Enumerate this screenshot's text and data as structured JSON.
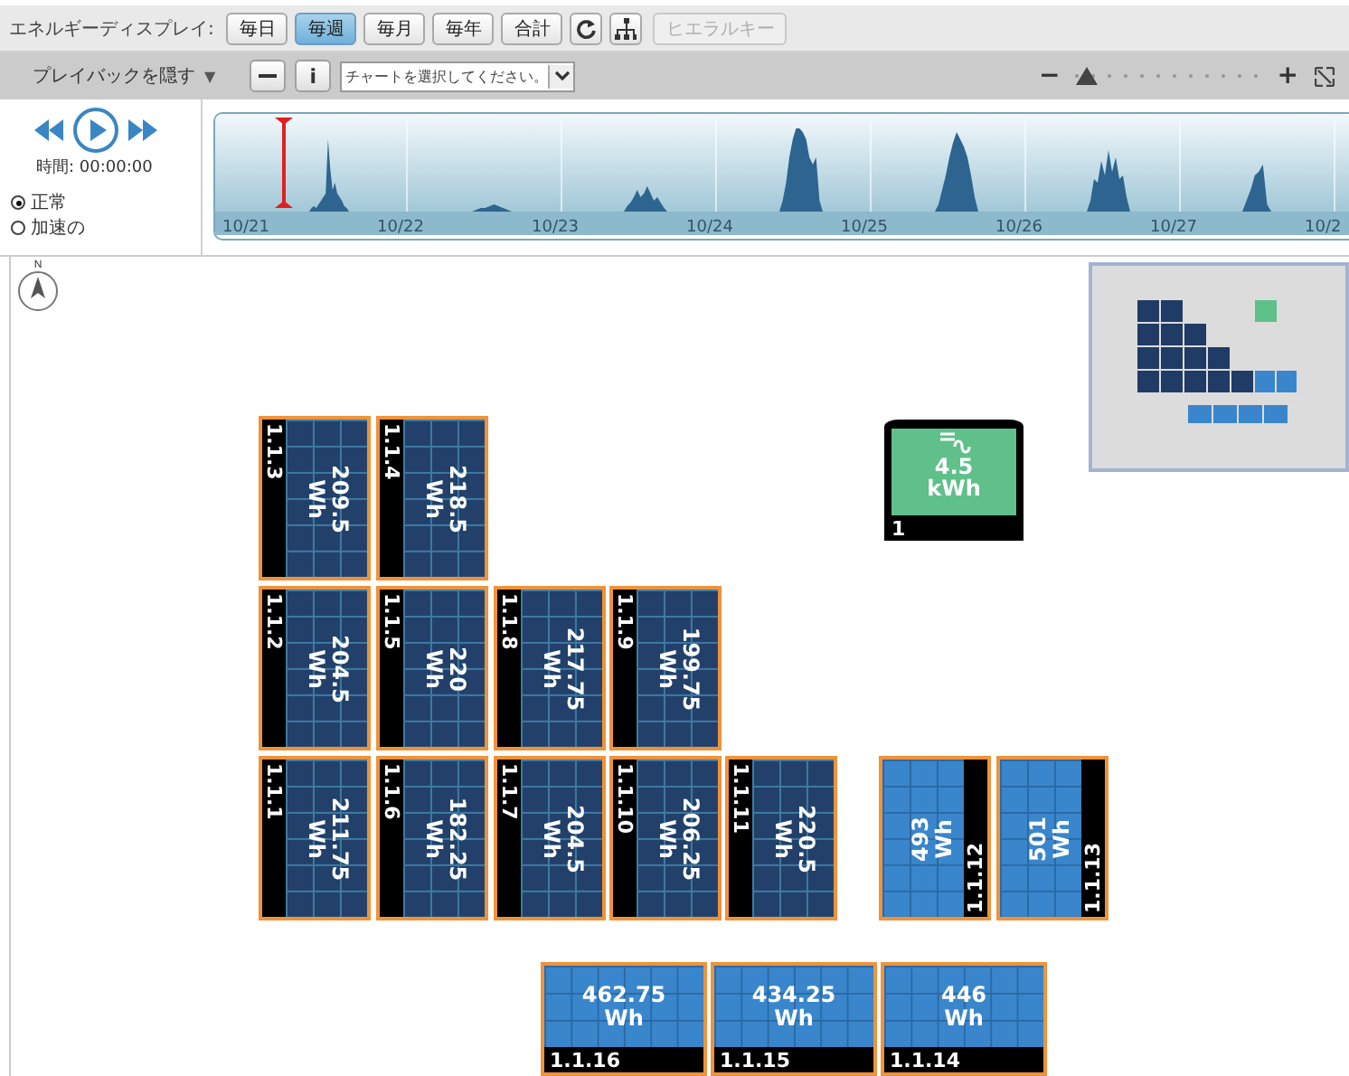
{
  "toolbar": {
    "label": "エネルギーディスプレイ:",
    "periods": [
      {
        "label": "毎日",
        "selected": false
      },
      {
        "label": "毎週",
        "selected": true
      },
      {
        "label": "毎月",
        "selected": false
      },
      {
        "label": "毎年",
        "selected": false
      },
      {
        "label": "合計",
        "selected": false
      }
    ],
    "hierarchy_button": {
      "label": "ヒエラルキー",
      "disabled": true
    }
  },
  "playback_bar": {
    "toggle": "プレイバックを隠す",
    "toggle_arrow": "▼",
    "info_button": "i",
    "chart_select": {
      "placeholder": "チャートを選択してください。"
    },
    "zoom_out": "−",
    "zoom_in": "+",
    "zoom": {
      "level": 0.03
    }
  },
  "player": {
    "time": "時間: 00:00:00",
    "speeds": [
      {
        "label": "正常",
        "selected": true
      },
      {
        "label": "加速の",
        "selected": false
      }
    ]
  },
  "timeline": {
    "level": 0.03,
    "dates": [
      "10/21",
      "10/22",
      "10/23",
      "10/24",
      "10/25",
      "10/26",
      "10/27",
      "10/2"
    ]
  },
  "compass": "N",
  "inverter": {
    "value": "4.5",
    "unit": "kWh",
    "label": "1"
  },
  "panels": [
    {
      "label": "1.1.3",
      "value": "209.5",
      "unit": "Wh",
      "kind": "left"
    },
    {
      "label": "1.1.4",
      "value": "218.5",
      "unit": "Wh",
      "kind": "left"
    },
    {
      "label": "1.1.2",
      "value": "204.5",
      "unit": "Wh",
      "kind": "left"
    },
    {
      "label": "1.1.5",
      "value": "220",
      "unit": "Wh",
      "kind": "left"
    },
    {
      "label": "1.1.8",
      "value": "217.75",
      "unit": "Wh",
      "kind": "left"
    },
    {
      "label": "1.1.9",
      "value": "199.75",
      "unit": "Wh",
      "kind": "left"
    },
    {
      "label": "1.1.1",
      "value": "211.75",
      "unit": "Wh",
      "kind": "left"
    },
    {
      "label": "1.1.6",
      "value": "182.25",
      "unit": "Wh",
      "kind": "left"
    },
    {
      "label": "1.1.7",
      "value": "204.5",
      "unit": "Wh",
      "kind": "left"
    },
    {
      "label": "1.1.10",
      "value": "206.25",
      "unit": "Wh",
      "kind": "left"
    },
    {
      "label": "1.1.11",
      "value": "220.5",
      "unit": "Wh",
      "kind": "left"
    },
    {
      "label": "1.1.12",
      "value": "493",
      "unit": "Wh",
      "kind": "right"
    },
    {
      "label": "1.1.13",
      "value": "501",
      "unit": "Wh",
      "kind": "right"
    },
    {
      "label": "1.1.16",
      "value": "462.75",
      "unit": "Wh",
      "kind": "bottom"
    },
    {
      "label": "1.1.15",
      "value": "434.25",
      "unit": "Wh",
      "kind": "bottom"
    },
    {
      "label": "1.1.14",
      "value": "446",
      "unit": "Wh",
      "kind": "bottom"
    }
  ]
}
